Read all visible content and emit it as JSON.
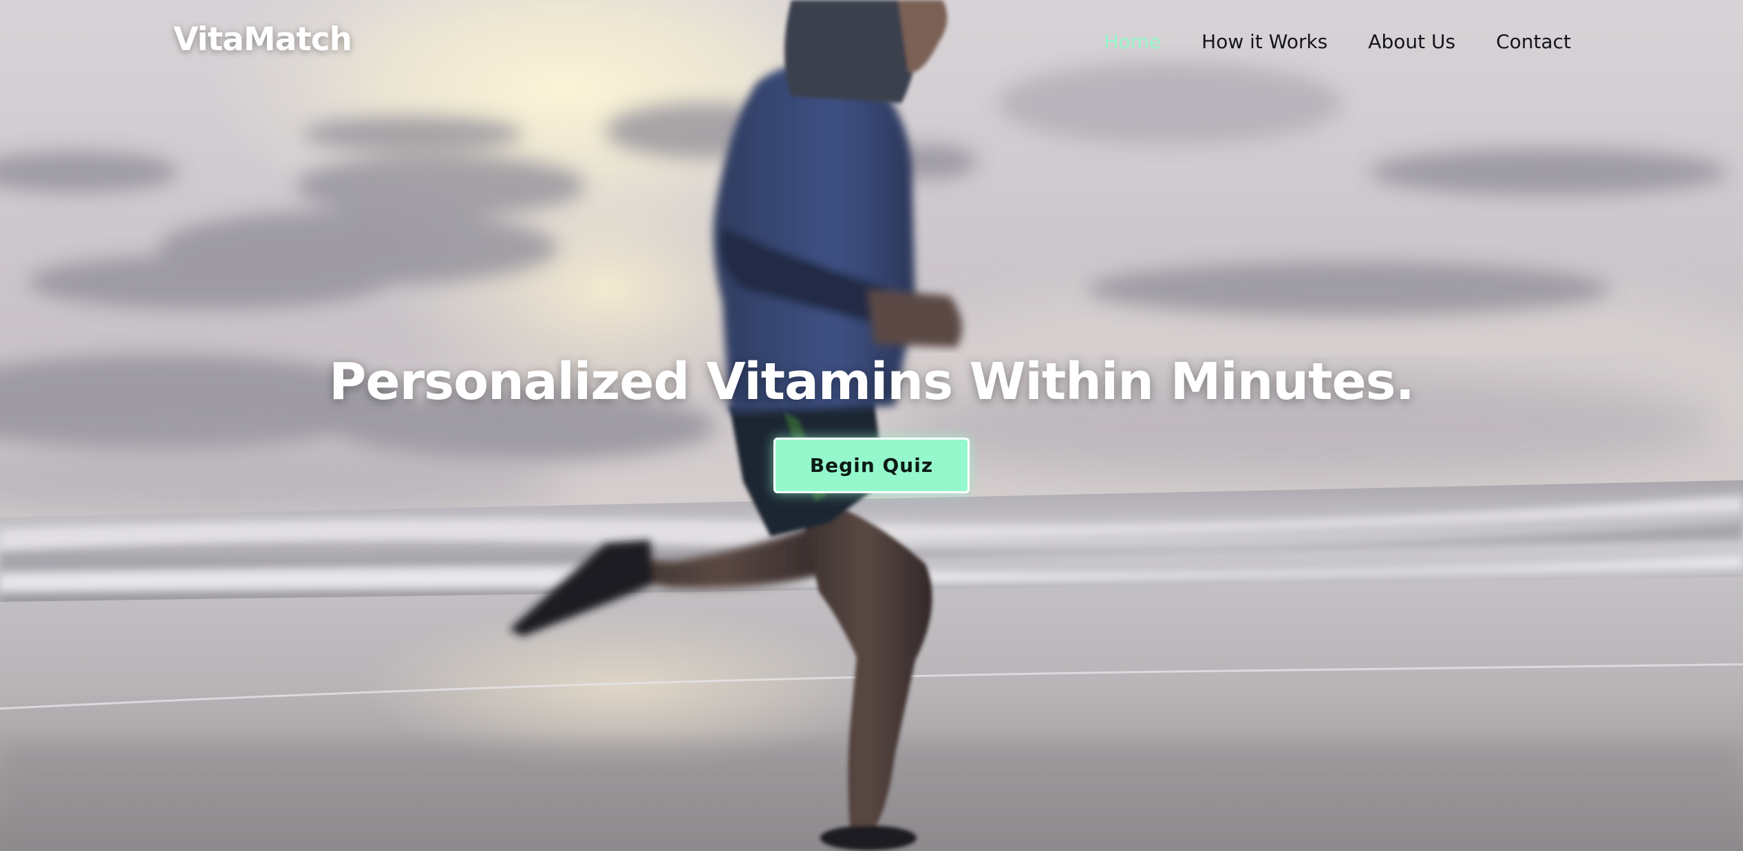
{
  "brand": {
    "name": "VitaMatch"
  },
  "nav": {
    "items": [
      {
        "label": "Home",
        "active": true
      },
      {
        "label": "How it Works",
        "active": false
      },
      {
        "label": "About Us",
        "active": false
      },
      {
        "label": "Contact",
        "active": false
      }
    ]
  },
  "hero": {
    "headline": "Personalized Vitamins Within Minutes.",
    "cta_label": "Begin Quiz",
    "background_image": "runner-on-beach-photo"
  },
  "colors": {
    "accent": "#95f7cc",
    "nav_text": "#14141c",
    "headline": "#ffffff"
  }
}
